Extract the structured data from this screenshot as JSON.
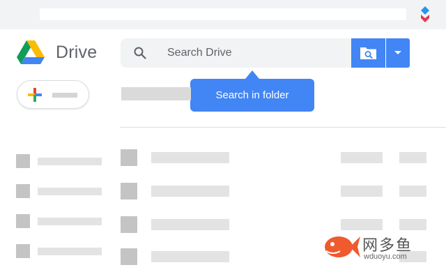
{
  "header": {
    "app_name": "Drive"
  },
  "search": {
    "placeholder": "Search Drive"
  },
  "tooltip": {
    "text": "Search in folder"
  },
  "colors": {
    "accent": "#4285f4",
    "chrome": "#f1f3f4"
  },
  "icons": {
    "logo": "google-drive-logo",
    "search": "search-icon",
    "folder_search": "folder-search-icon",
    "dropdown": "caret-down-icon",
    "new": "plus-icon",
    "extension": "extension-icon"
  },
  "watermark": {
    "name": "网多鱼",
    "url": "wduoyu.com"
  }
}
